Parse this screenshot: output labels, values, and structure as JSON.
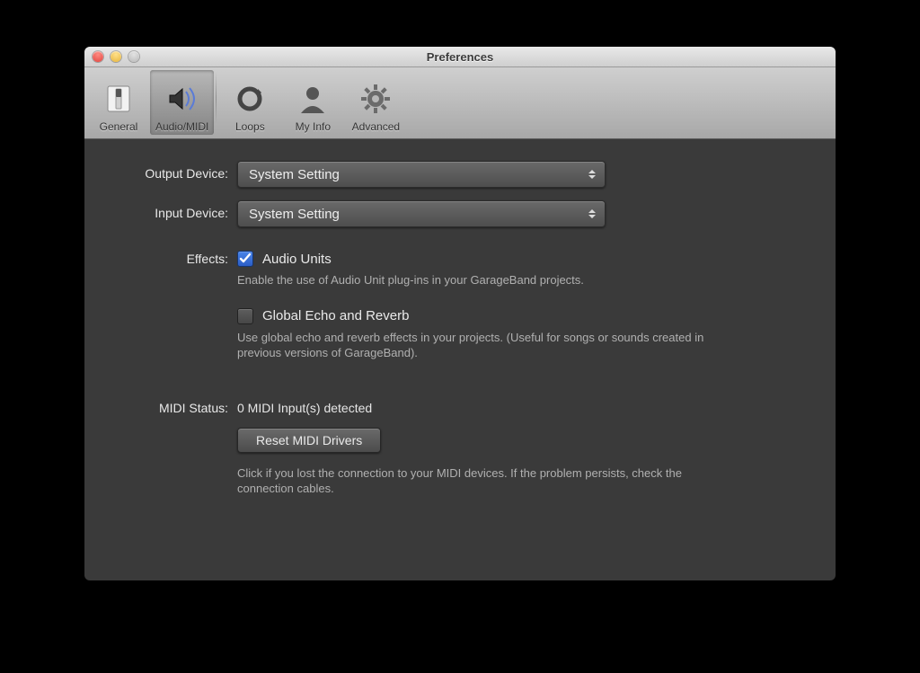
{
  "window": {
    "title": "Preferences"
  },
  "toolbar": {
    "items": [
      {
        "label": "General"
      },
      {
        "label": "Audio/MIDI"
      },
      {
        "label": "Loops"
      },
      {
        "label": "My Info"
      },
      {
        "label": "Advanced"
      }
    ],
    "selected_index": 1
  },
  "form": {
    "output_device": {
      "label": "Output Device:",
      "value": "System Setting"
    },
    "input_device": {
      "label": "Input Device:",
      "value": "System Setting"
    },
    "effects": {
      "label": "Effects:",
      "audio_units": {
        "checked": true,
        "title": "Audio Units",
        "desc": "Enable the use of Audio Unit plug-ins in your GarageBand projects."
      },
      "global_echo": {
        "checked": false,
        "title": "Global Echo and Reverb",
        "desc": "Use global echo and reverb effects in your projects. (Useful for songs or sounds created in previous versions of GarageBand)."
      }
    },
    "midi": {
      "label": "MIDI Status:",
      "status": "0 MIDI Input(s) detected",
      "reset_button": "Reset MIDI Drivers",
      "desc": "Click if you lost the connection to your MIDI devices. If the problem persists, check the connection cables."
    }
  }
}
